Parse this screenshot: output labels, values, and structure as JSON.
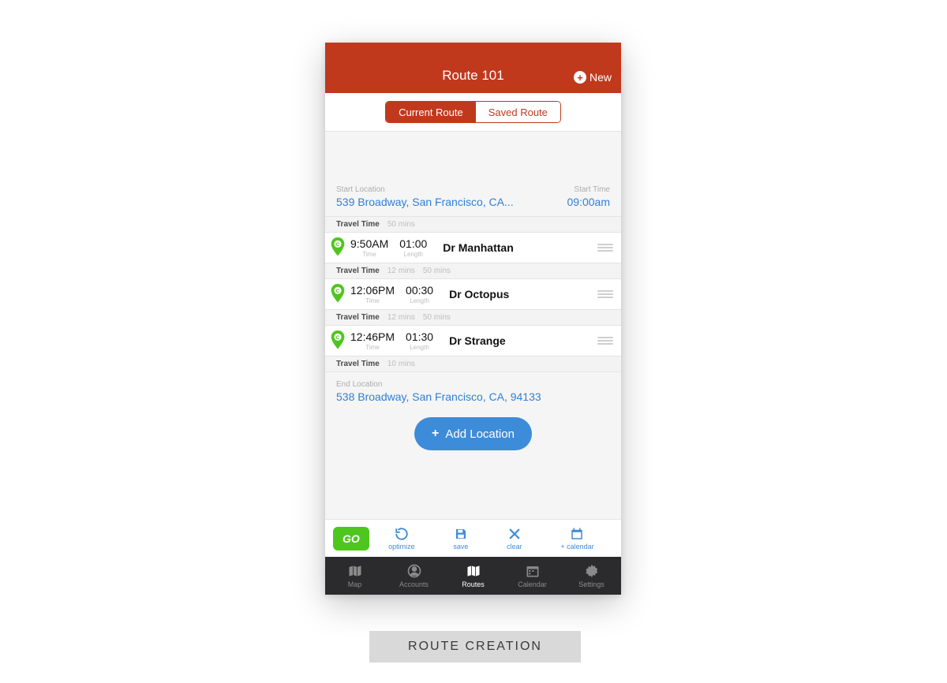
{
  "header": {
    "title": "Route 101",
    "new_label": "New"
  },
  "tabs": {
    "current": "Current Route",
    "saved": "Saved Route"
  },
  "start": {
    "label": "Start Location",
    "address": "539 Broadway, San Francisco, CA...",
    "time_label": "Start Time",
    "time": "09:00am"
  },
  "travel_labels": {
    "prefix": "Travel Time",
    "time_label": "Time",
    "length_label": "Length"
  },
  "segments": [
    {
      "travel_primary": "50 mins",
      "travel_secondary": "",
      "time": "9:50AM",
      "length": "01:00",
      "name": "Dr Manhattan"
    },
    {
      "travel_primary": "12 mins",
      "travel_secondary": "50 mins",
      "time": "12:06PM",
      "length": "00:30",
      "name": "Dr Octopus"
    },
    {
      "travel_primary": "12 mins",
      "travel_secondary": "50 mins",
      "time": "12:46PM",
      "length": "01:30",
      "name": "Dr Strange"
    }
  ],
  "final_travel": "10 mins",
  "end": {
    "label": "End Location",
    "address": "538 Broadway, San Francisco, CA, 94133"
  },
  "add_location": "Add Location",
  "actions": {
    "go": "GO",
    "optimize": "optimize",
    "save": "save",
    "clear": "clear",
    "calendar": "+ calendar"
  },
  "nav": {
    "map": "Map",
    "accounts": "Accounts",
    "routes": "Routes",
    "calendar": "Calendar",
    "settings": "Settings"
  },
  "caption": "ROUTE CREATION"
}
